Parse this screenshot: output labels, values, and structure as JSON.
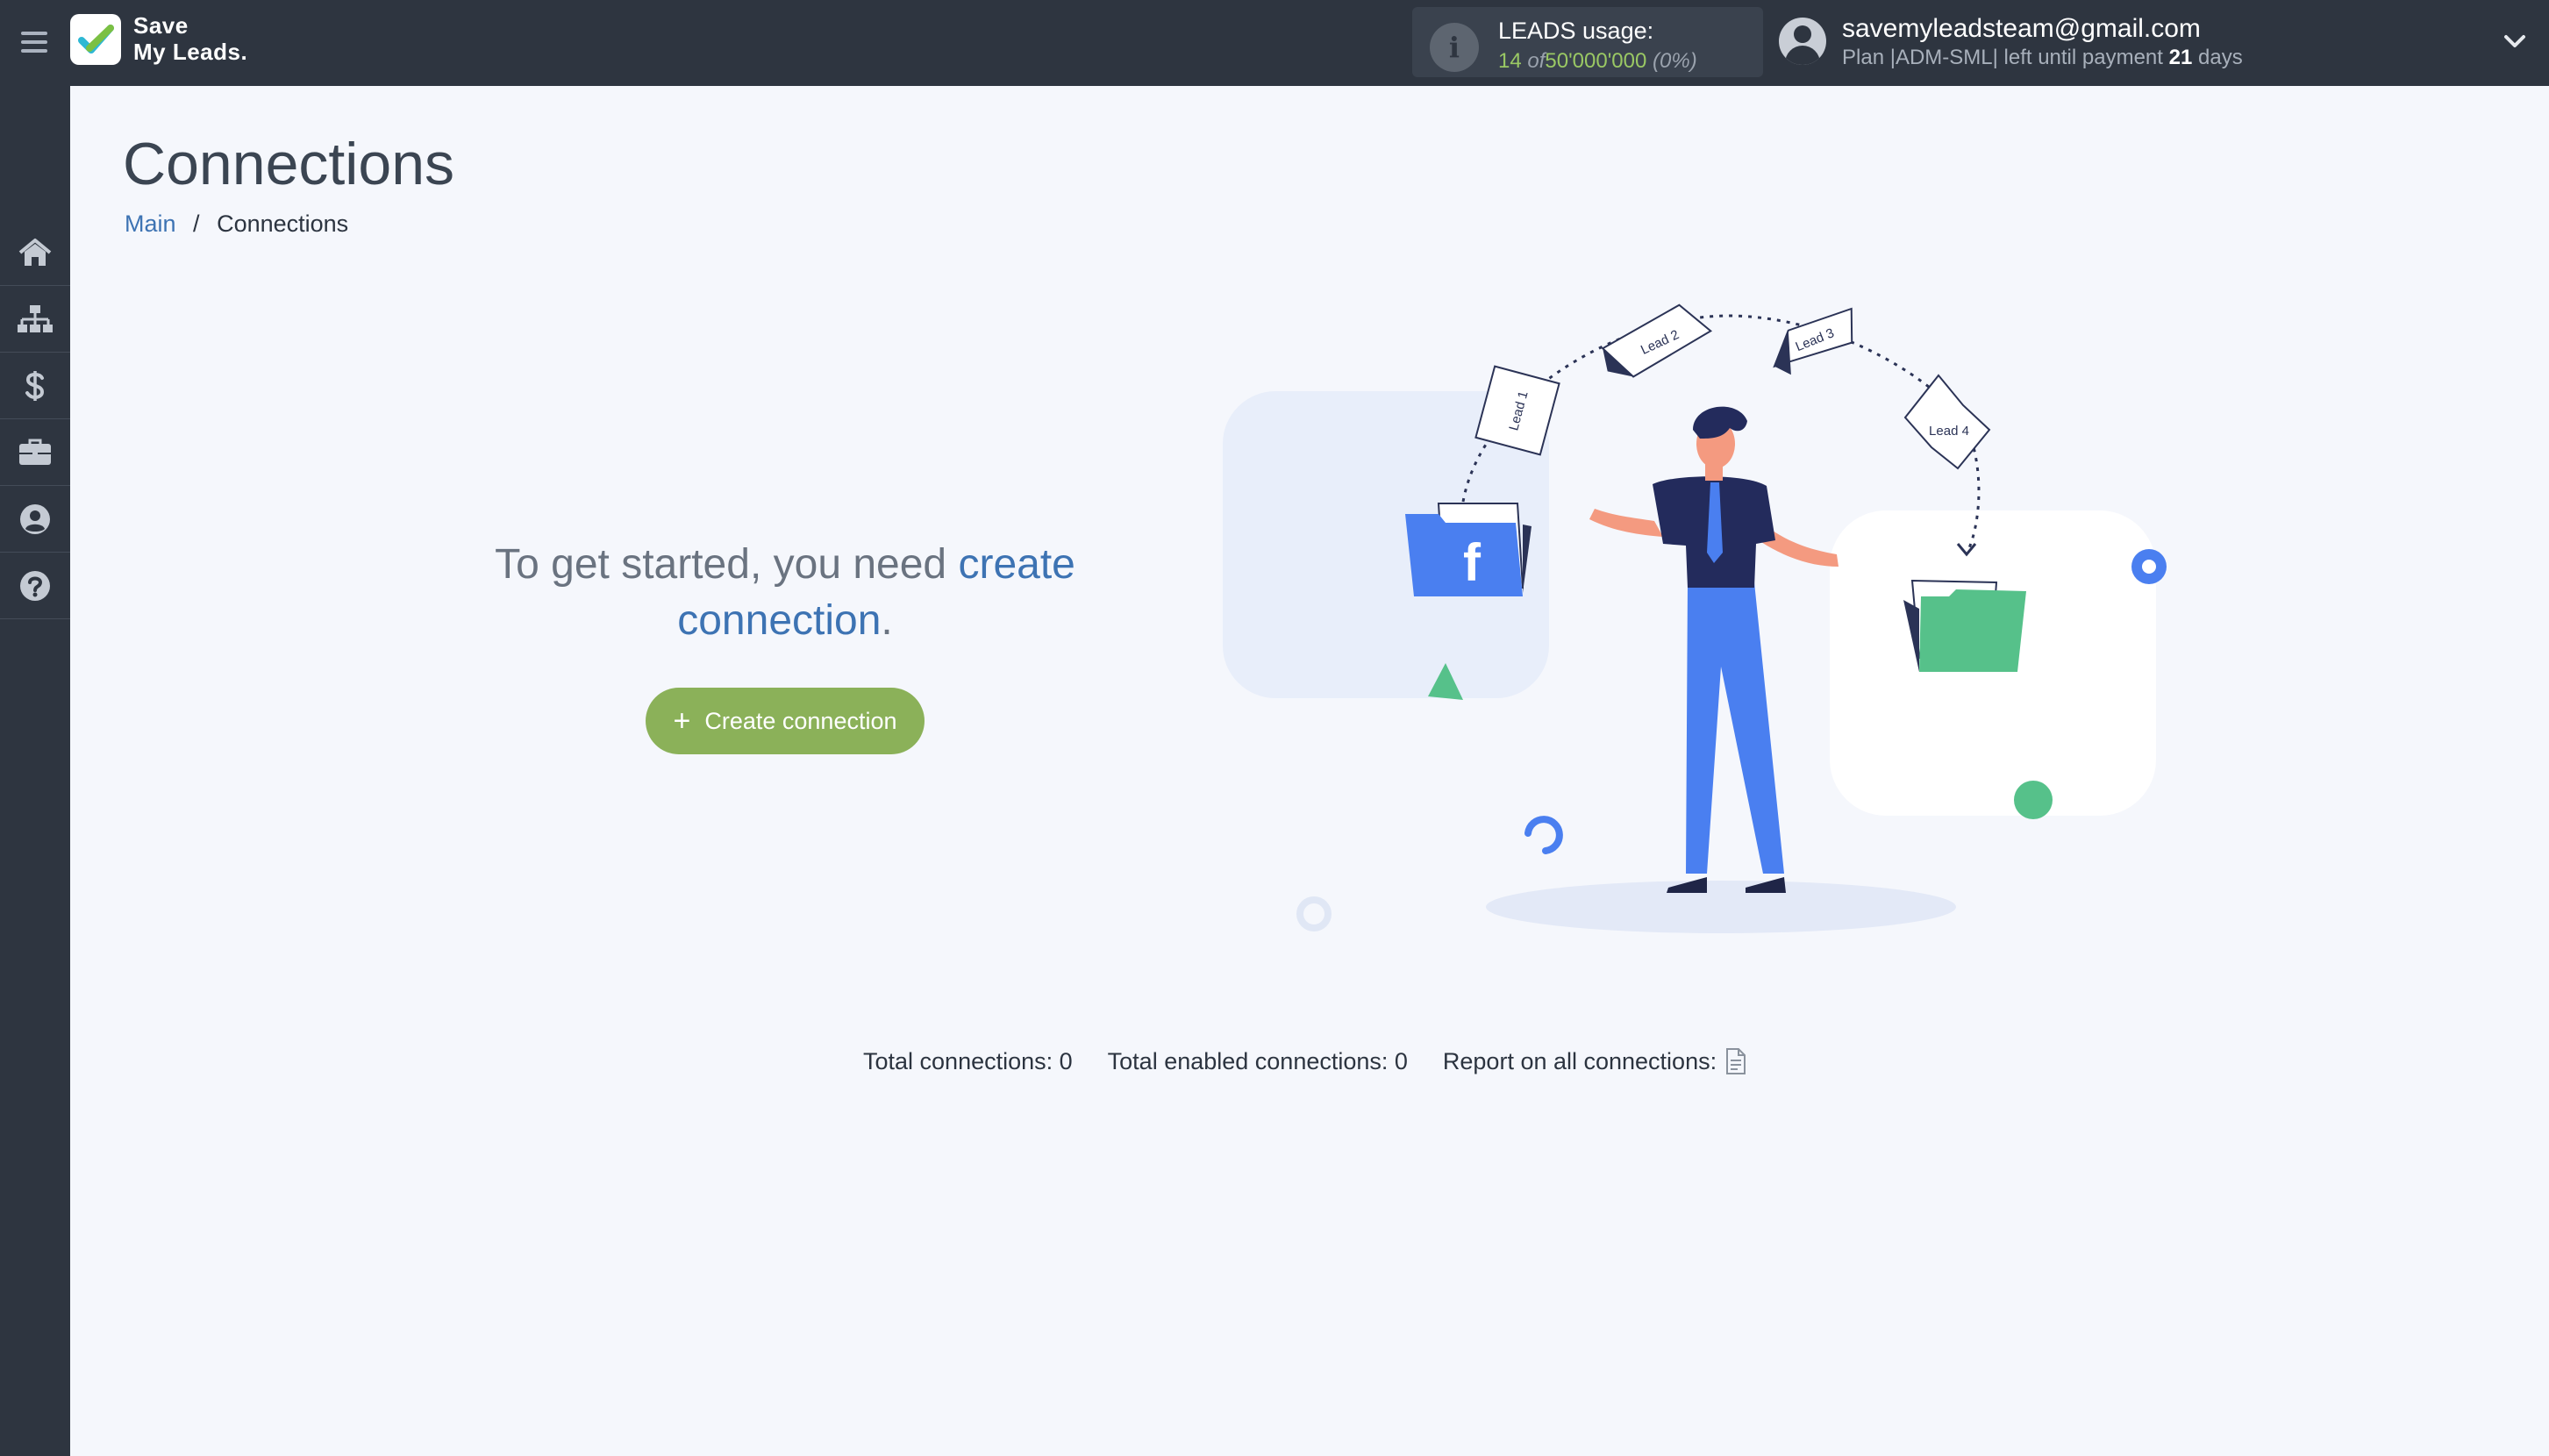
{
  "brand": {
    "line1": "Save",
    "line2": "My Leads."
  },
  "usage": {
    "title": "LEADS usage:",
    "used": "14",
    "of": "of",
    "limit": "50'000'000",
    "percent": "(0%)"
  },
  "account": {
    "email": "savemyleadsteam@gmail.com",
    "plan_prefix": "Plan |ADM-SML| left until payment",
    "days": "21",
    "days_suffix": "days"
  },
  "sidebar": {
    "items": [
      {
        "icon": "home-icon"
      },
      {
        "icon": "sitemap-icon"
      },
      {
        "icon": "dollar-icon"
      },
      {
        "icon": "briefcase-icon"
      },
      {
        "icon": "user-circle-icon"
      },
      {
        "icon": "question-circle-icon"
      }
    ]
  },
  "page": {
    "title": "Connections",
    "breadcrumb": {
      "home": "Main",
      "separator": "/",
      "current": "Connections"
    }
  },
  "intro": {
    "text_before": "To get started, you need",
    "link_text": "create connection",
    "text_after": "."
  },
  "actions": {
    "create_label": "Create connection"
  },
  "illustration": {
    "labels": [
      "Lead 1",
      "Lead 2",
      "Lead 3",
      "Lead 4"
    ],
    "source_letter": "f"
  },
  "stats": {
    "total": "Total connections: 0",
    "enabled": "Total enabled connections: 0",
    "report": "Report on all connections:"
  },
  "colors": {
    "topbar": "#2e3540",
    "accent_green": "#8bb159",
    "link_blue": "#3d73b3",
    "usage_green": "#9ac864"
  }
}
